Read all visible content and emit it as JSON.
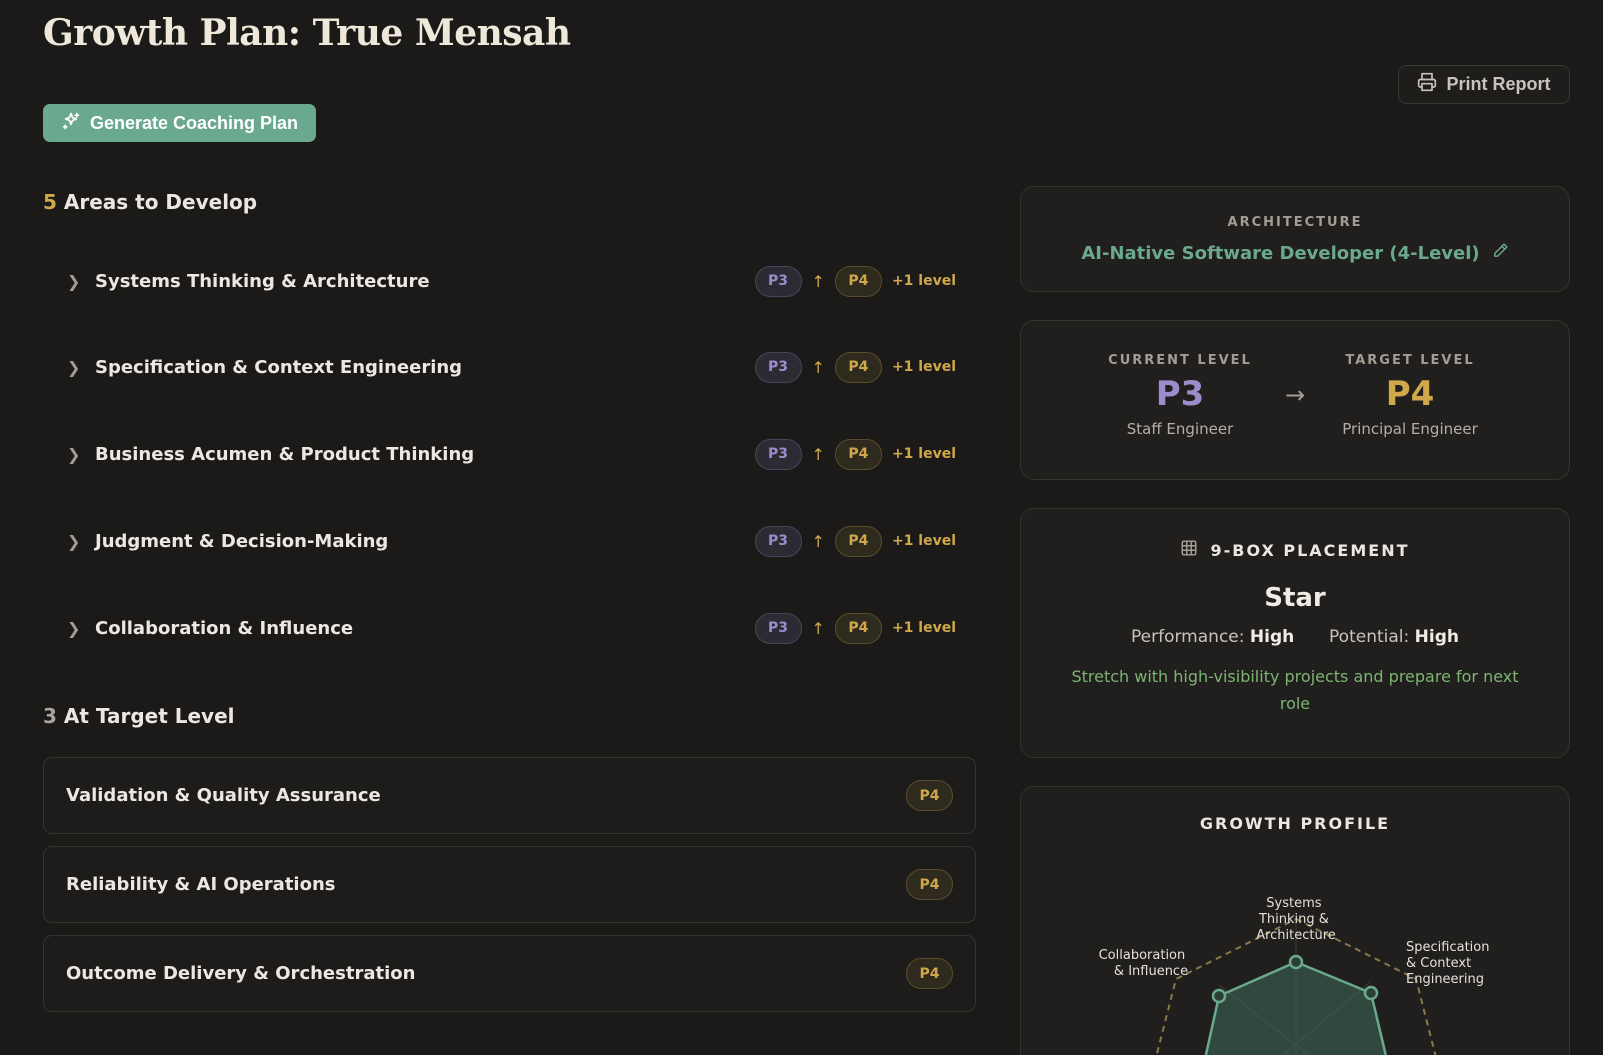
{
  "header": {
    "title": "Growth Plan: True Mensah",
    "print_label": "Print Report",
    "generate_label": "Generate Coaching Plan"
  },
  "develop": {
    "count": "5",
    "title": "Areas to Develop",
    "items": [
      {
        "label": "Systems Thinking & Architecture",
        "current": "P3",
        "target": "P4",
        "delta": "+1 level"
      },
      {
        "label": "Specification & Context Engineering",
        "current": "P3",
        "target": "P4",
        "delta": "+1 level"
      },
      {
        "label": "Business Acumen & Product Thinking",
        "current": "P3",
        "target": "P4",
        "delta": "+1 level"
      },
      {
        "label": "Judgment & Decision-Making",
        "current": "P3",
        "target": "P4",
        "delta": "+1 level"
      },
      {
        "label": "Collaboration & Influence",
        "current": "P3",
        "target": "P4",
        "delta": "+1 level"
      }
    ]
  },
  "at_target": {
    "count": "3",
    "title": "At Target Level",
    "items": [
      {
        "label": "Validation & Quality Assurance",
        "level": "P4"
      },
      {
        "label": "Reliability & AI Operations",
        "level": "P4"
      },
      {
        "label": "Outcome Delivery & Orchestration",
        "level": "P4"
      }
    ]
  },
  "architecture": {
    "caption": "ARCHITECTURE",
    "name": "AI-Native Software Developer (4-Level)"
  },
  "levels": {
    "current_caption": "CURRENT LEVEL",
    "current_value": "P3",
    "current_title": "Staff Engineer",
    "target_caption": "TARGET LEVEL",
    "target_value": "P4",
    "target_title": "Principal Engineer"
  },
  "nine_box": {
    "caption": "9-BOX PLACEMENT",
    "placement": "Star",
    "performance_label": "Performance:",
    "performance_value": "High",
    "potential_label": "Potential:",
    "potential_value": "High",
    "advice": "Stretch with high-visibility projects and prepare for next role"
  },
  "growth_profile": {
    "caption": "GROWTH PROFILE",
    "axes": [
      {
        "line1": "Systems",
        "line2": "Thinking &",
        "line3": "Architecture"
      },
      {
        "line1": "Specification",
        "line2": "& Context",
        "line3": "Engineering"
      },
      {
        "line1": "Collaboration",
        "line2": "& Influence",
        "line3": ""
      }
    ]
  },
  "colors": {
    "accent_green": "#6aa88f",
    "gold": "#d0a84a",
    "purple": "#9c8ccc",
    "advice_green": "#7cb572"
  },
  "icons": {
    "print": "printer-icon",
    "generate": "sparkles-icon",
    "edit": "pencil-icon",
    "grid": "grid-icon"
  }
}
